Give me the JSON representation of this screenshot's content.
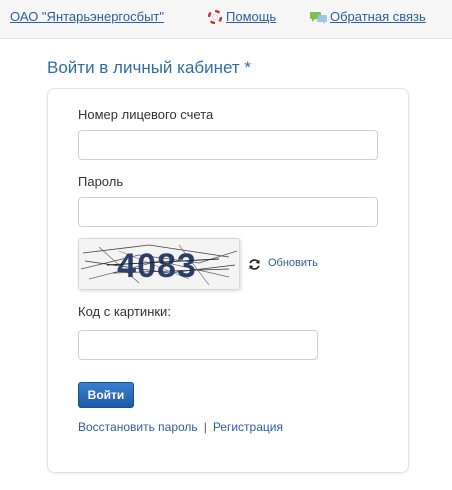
{
  "topnav": {
    "company_link": "ОАО \"Янтарьэнергосбыт\"",
    "help_link": "Помощь",
    "help_icon": "lifebuoy-icon",
    "feedback_link": "Обратная связь",
    "feedback_icon": "speech-bubbles-icon"
  },
  "page": {
    "title": "Войти в личный кабинет *"
  },
  "form": {
    "account_label": "Номер лицевого счета",
    "account_value": "",
    "password_label": "Пароль",
    "password_value": "",
    "captcha_text": "4083",
    "refresh_label": "Обновить",
    "refresh_icon": "refresh-icon",
    "captcha_label": "Код с картинки:",
    "captcha_value": "",
    "submit_label": "Войти"
  },
  "links": {
    "restore_password": "Восстановить пароль",
    "separator": "|",
    "register": "Регистрация"
  },
  "colors": {
    "link": "#2b5f9e",
    "title": "#2e6ea6",
    "button": "#1d5aa8"
  }
}
